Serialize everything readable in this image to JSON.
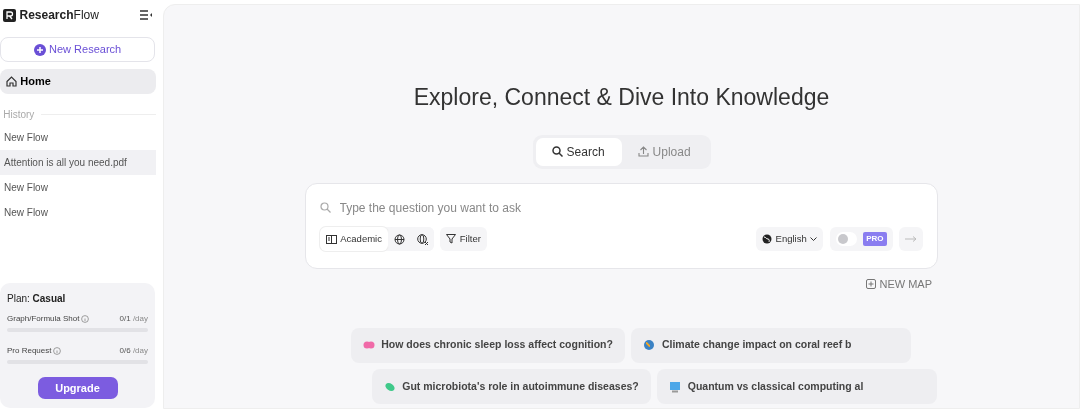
{
  "brand": {
    "bold": "Research",
    "light": "Flow"
  },
  "new_button": "New Research",
  "nav": [
    {
      "label": "Home",
      "selected": true
    }
  ],
  "history": {
    "heading": "History",
    "items": [
      {
        "label": "New Flow",
        "selected": false
      },
      {
        "label": "Attention is all you need.pdf",
        "selected": true
      },
      {
        "label": "New Flow",
        "selected": false
      },
      {
        "label": "New Flow",
        "selected": false
      }
    ]
  },
  "plan": {
    "label": "Plan:",
    "name": "Casual",
    "quotas": [
      {
        "name": "Graph/Formula Shot",
        "used": "0/1",
        "unit": "/day",
        "level": 0
      },
      {
        "name": "Pro Request",
        "used": "0/6",
        "unit": "/day",
        "level": 0
      }
    ],
    "button": "Upgrade"
  },
  "headline": "Explore, Connect & Dive Into Knowledge",
  "mode_tabs": [
    {
      "label": "Search",
      "selected": true
    },
    {
      "label": "Upload",
      "selected": false
    }
  ],
  "search": {
    "placeholder": "Type the question you want to ask",
    "sources": [
      {
        "kind": "academic",
        "label": "Academic",
        "selected": true
      },
      {
        "kind": "web",
        "selected": false
      },
      {
        "kind": "noweb",
        "selected": false
      }
    ],
    "filter": "Filter",
    "language": "English",
    "pro": {
      "label": "PRO",
      "on": false
    }
  },
  "new_map": "NEW MAP",
  "suggestions": [
    {
      "text": "How does chronic sleep loss affect cognition?"
    },
    {
      "text": "Climate change impact on coral reef b"
    },
    {
      "text": "Gut microbiota's role in autoimmune diseases?"
    },
    {
      "text": "Quantum vs classical computing al"
    }
  ]
}
